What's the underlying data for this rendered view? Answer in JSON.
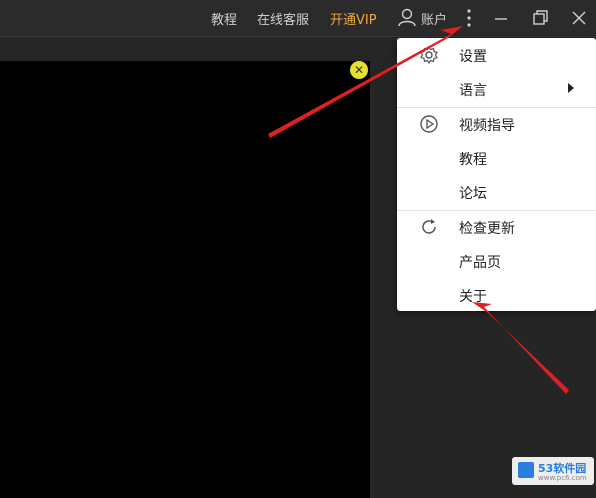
{
  "titlebar": {
    "links": [
      "教程",
      "在线客服",
      "开通VIP"
    ],
    "account_label": "账户",
    "icons": [
      "user-icon",
      "more-vertical-icon",
      "minimize-icon",
      "restore-icon",
      "close-icon"
    ],
    "vip_color": "#f0a83a"
  },
  "video_close_icon": "close-icon",
  "menu": {
    "items": [
      {
        "label": "设置",
        "icon": "gear-icon"
      },
      {
        "label": "语言",
        "icon": "",
        "submenu": true
      },
      {
        "label": "视频指导",
        "icon": "play-circle-icon"
      },
      {
        "label": "教程",
        "icon": ""
      },
      {
        "label": "论坛",
        "icon": ""
      },
      {
        "label": "检查更新",
        "icon": "refresh-icon"
      },
      {
        "label": "产品页",
        "icon": ""
      },
      {
        "label": "关于",
        "icon": ""
      }
    ]
  },
  "annotation_color": "#e02020",
  "watermark": {
    "text": "53软件园",
    "sub": "www.pc6.com"
  }
}
